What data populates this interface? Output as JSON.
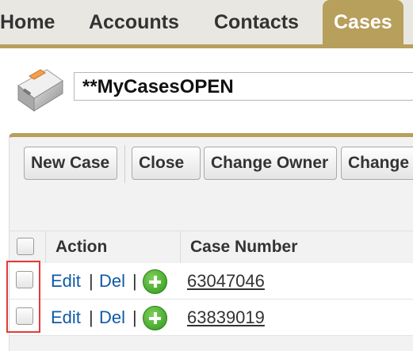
{
  "tabs": [
    {
      "label": "Home"
    },
    {
      "label": "Accounts"
    },
    {
      "label": "Contacts"
    },
    {
      "label": "Cases",
      "active": true
    }
  ],
  "view": {
    "selected": "**MyCasesOPEN",
    "icon": "briefcase-icon"
  },
  "toolbar": {
    "new_case": "New Case",
    "close": "Close",
    "change_owner": "Change Owner",
    "change": "Change"
  },
  "table": {
    "headers": {
      "action": "Action",
      "case_number": "Case Number"
    },
    "action_links": {
      "edit": "Edit",
      "del": "Del",
      "separator": "|"
    },
    "rows": [
      {
        "case_number": "63047046"
      },
      {
        "case_number": "63839019"
      }
    ]
  },
  "colors": {
    "accent": "#b79f5c",
    "link": "#0f5aa6",
    "highlight": "#e53a3a",
    "add": "#3aa825"
  }
}
